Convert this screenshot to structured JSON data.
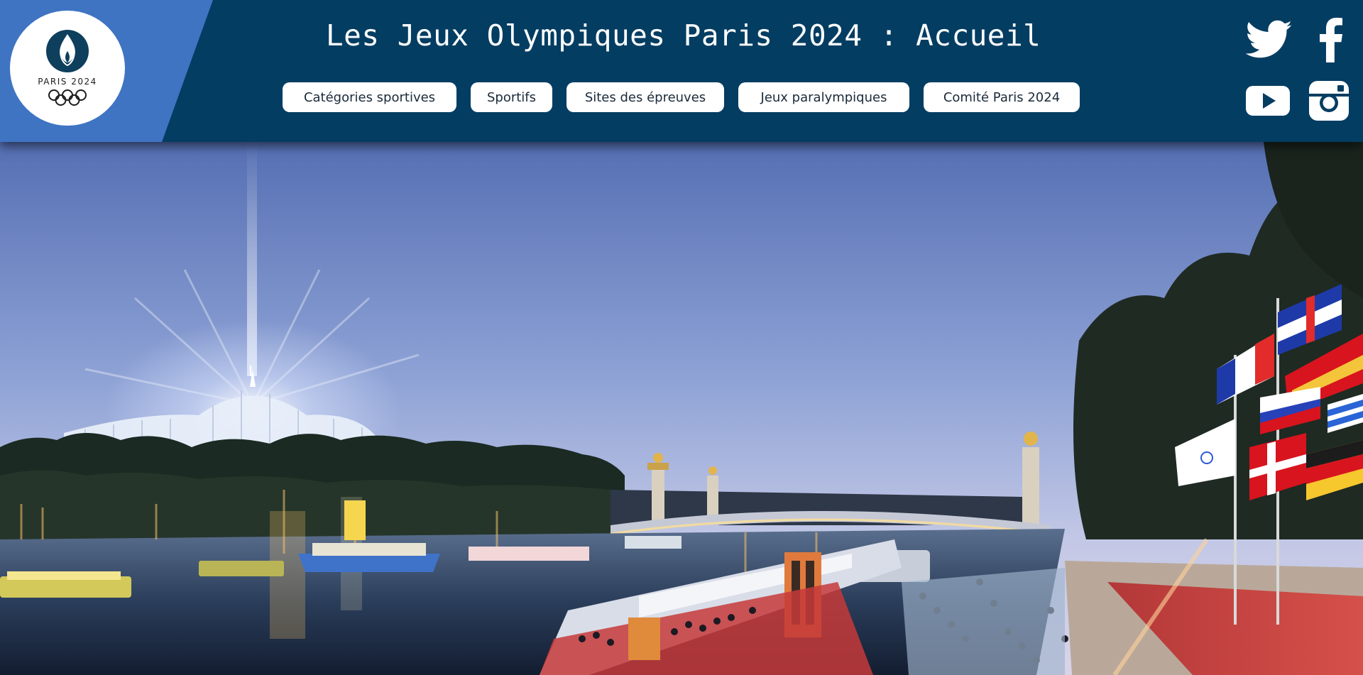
{
  "page": {
    "title": "Les Jeux Olympiques Paris 2024 : Accueil"
  },
  "logo": {
    "text": "PARIS 2024",
    "icon": "paris-2024-flame-icon"
  },
  "nav": {
    "items": [
      {
        "label": "Catégories sportives"
      },
      {
        "label": "Sportifs"
      },
      {
        "label": "Sites des épreuves"
      },
      {
        "label": "Jeux paralympiques"
      },
      {
        "label": "Comité Paris 2024"
      }
    ]
  },
  "social": {
    "icons": [
      "twitter-icon",
      "facebook-icon",
      "youtube-icon",
      "instagram-icon"
    ]
  },
  "hero": {
    "description_icon": "seine-river-night-scene"
  },
  "colors": {
    "header_bg": "#043d62",
    "logo_band": "#3f74c3",
    "button_bg": "#ffffff",
    "button_text": "#1a2a3a"
  }
}
